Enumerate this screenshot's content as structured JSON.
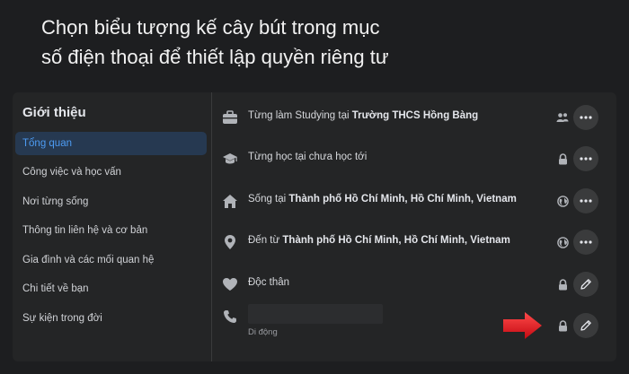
{
  "caption": {
    "line1": "Chọn biểu tượng kế cây bút trong mục",
    "line2": "số điện thoại để thiết lập quyền riêng tư"
  },
  "sidebar": {
    "title": "Giới thiệu",
    "items": [
      {
        "label": "Tổng quan",
        "active": true
      },
      {
        "label": "Công việc và học vấn"
      },
      {
        "label": "Nơi từng sống"
      },
      {
        "label": "Thông tin liên hệ và cơ bản"
      },
      {
        "label": "Gia đình và các mối quan hệ"
      },
      {
        "label": "Chi tiết về bạn"
      },
      {
        "label": "Sự kiện trong đời"
      }
    ]
  },
  "rows": [
    {
      "icon": "briefcase-icon",
      "prefix": "Từng làm Studying tại ",
      "bold": "Trường THCS Hồng Bàng",
      "privacy": "friends-icon",
      "action": "more"
    },
    {
      "icon": "graduation-cap-icon",
      "prefix": "Từng học tại chưa học tới",
      "bold": "",
      "privacy": "lock-icon",
      "action": "more"
    },
    {
      "icon": "home-icon",
      "prefix": "Sống tại ",
      "bold": "Thành phố Hồ Chí Minh, Hồ Chí Minh, Vietnam",
      "privacy": "globe-icon",
      "action": "more"
    },
    {
      "icon": "location-pin-icon",
      "prefix": "Đến từ ",
      "bold": "Thành phố Hồ Chí Minh, Hồ Chí Minh, Vietnam",
      "privacy": "globe-icon",
      "action": "more"
    },
    {
      "icon": "heart-icon",
      "prefix": "Độc thân",
      "bold": "",
      "privacy": "lock-icon",
      "action": "edit"
    }
  ],
  "phone": {
    "icon": "phone-icon",
    "sub_label": "Di động",
    "privacy": "lock-icon",
    "action": "edit"
  },
  "colors": {
    "accent": "#4d9bf2",
    "arrow": "#e3121b",
    "panel": "#242526"
  }
}
